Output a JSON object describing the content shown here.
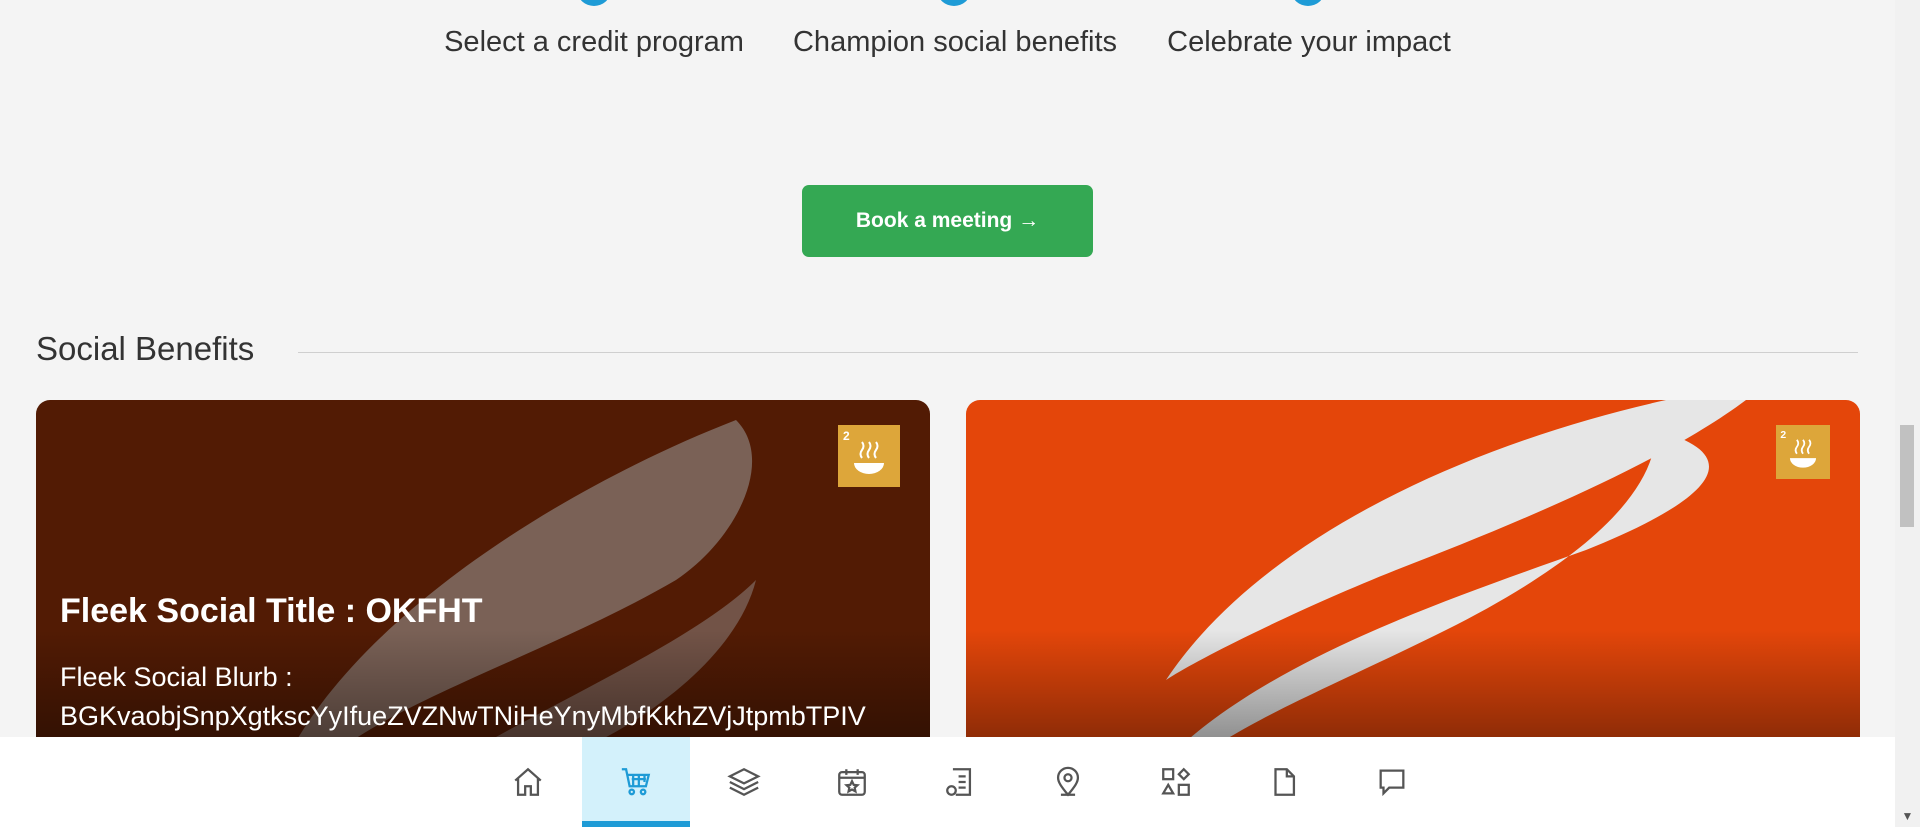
{
  "steps": [
    {
      "label": "Select a credit program"
    },
    {
      "label": "Champion social benefits"
    },
    {
      "label": "Celebrate your impact"
    }
  ],
  "cta": {
    "book_label": "Book a meeting →"
  },
  "section": {
    "title": "Social Benefits"
  },
  "cards": [
    {
      "title": "Fleek Social Title : OKFHT",
      "blurb_line1": "Fleek Social Blurb :",
      "blurb_line2": "BGKvaobjSnpXgtkscYyIfueZVZNwTNiHeYnyMbfKkhZVjJtpmbTPIV",
      "badge_icon": "sdg-2-zero-hunger-icon",
      "background_color": "#521b04"
    },
    {
      "title": "",
      "badge_icon": "sdg-2-zero-hunger-icon",
      "background_color": "#e4460a"
    }
  ],
  "bottom_nav": {
    "items": [
      {
        "icon": "home-icon"
      },
      {
        "icon": "cart-icon",
        "active": true
      },
      {
        "icon": "layers-icon"
      },
      {
        "icon": "calendar-star-icon"
      },
      {
        "icon": "document-list-icon"
      },
      {
        "icon": "map-pin-icon"
      },
      {
        "icon": "shapes-icon"
      },
      {
        "icon": "file-icon"
      },
      {
        "icon": "chat-icon"
      }
    ]
  },
  "colors": {
    "accent": "#1e9bd6",
    "cta_green": "#34a853",
    "sdg2_gold": "#dda63a"
  }
}
